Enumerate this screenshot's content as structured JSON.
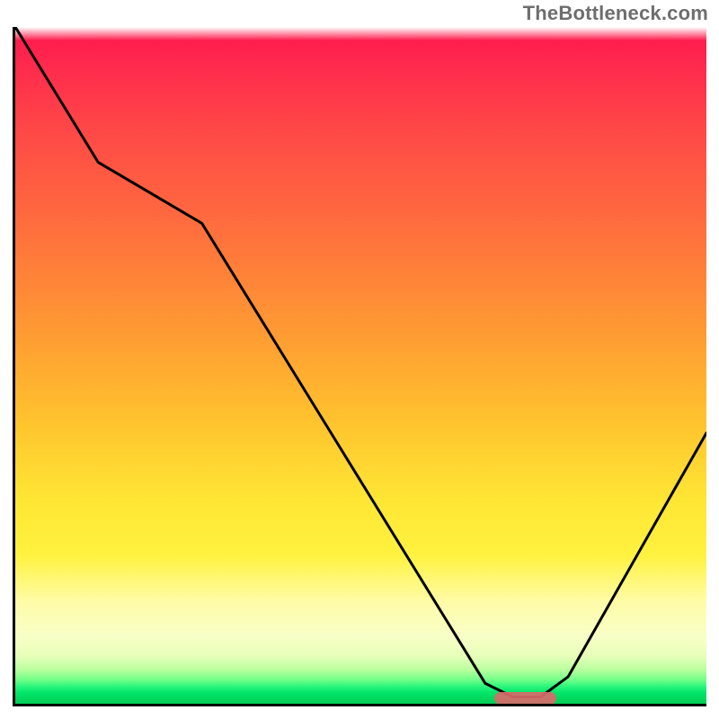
{
  "watermark": "TheBottleneck.com",
  "chart_data": {
    "type": "line",
    "title": "",
    "xlabel": "",
    "ylabel": "",
    "xlim": [
      0,
      100
    ],
    "ylim": [
      0,
      100
    ],
    "grid": false,
    "series": [
      {
        "name": "curve",
        "x": [
          0,
          12,
          27,
          68,
          72,
          76,
          80,
          100
        ],
        "y": [
          100,
          80,
          71,
          3,
          1,
          1,
          4,
          40
        ]
      }
    ],
    "marker": {
      "x_start": 69,
      "x_end": 78,
      "y": 0.8
    },
    "background_gradient": {
      "stops": [
        {
          "pos": 0.0,
          "color": "#ffffff"
        },
        {
          "pos": 0.02,
          "color": "#ff1d4d"
        },
        {
          "pos": 0.15,
          "color": "#ff4747"
        },
        {
          "pos": 0.3,
          "color": "#ff6f3d"
        },
        {
          "pos": 0.45,
          "color": "#ff9a33"
        },
        {
          "pos": 0.58,
          "color": "#ffc22e"
        },
        {
          "pos": 0.7,
          "color": "#ffe634"
        },
        {
          "pos": 0.85,
          "color": "#fffca8"
        },
        {
          "pos": 0.93,
          "color": "#e6ffb9"
        },
        {
          "pos": 0.97,
          "color": "#28f57a"
        },
        {
          "pos": 1.0,
          "color": "#00d058"
        }
      ]
    }
  }
}
